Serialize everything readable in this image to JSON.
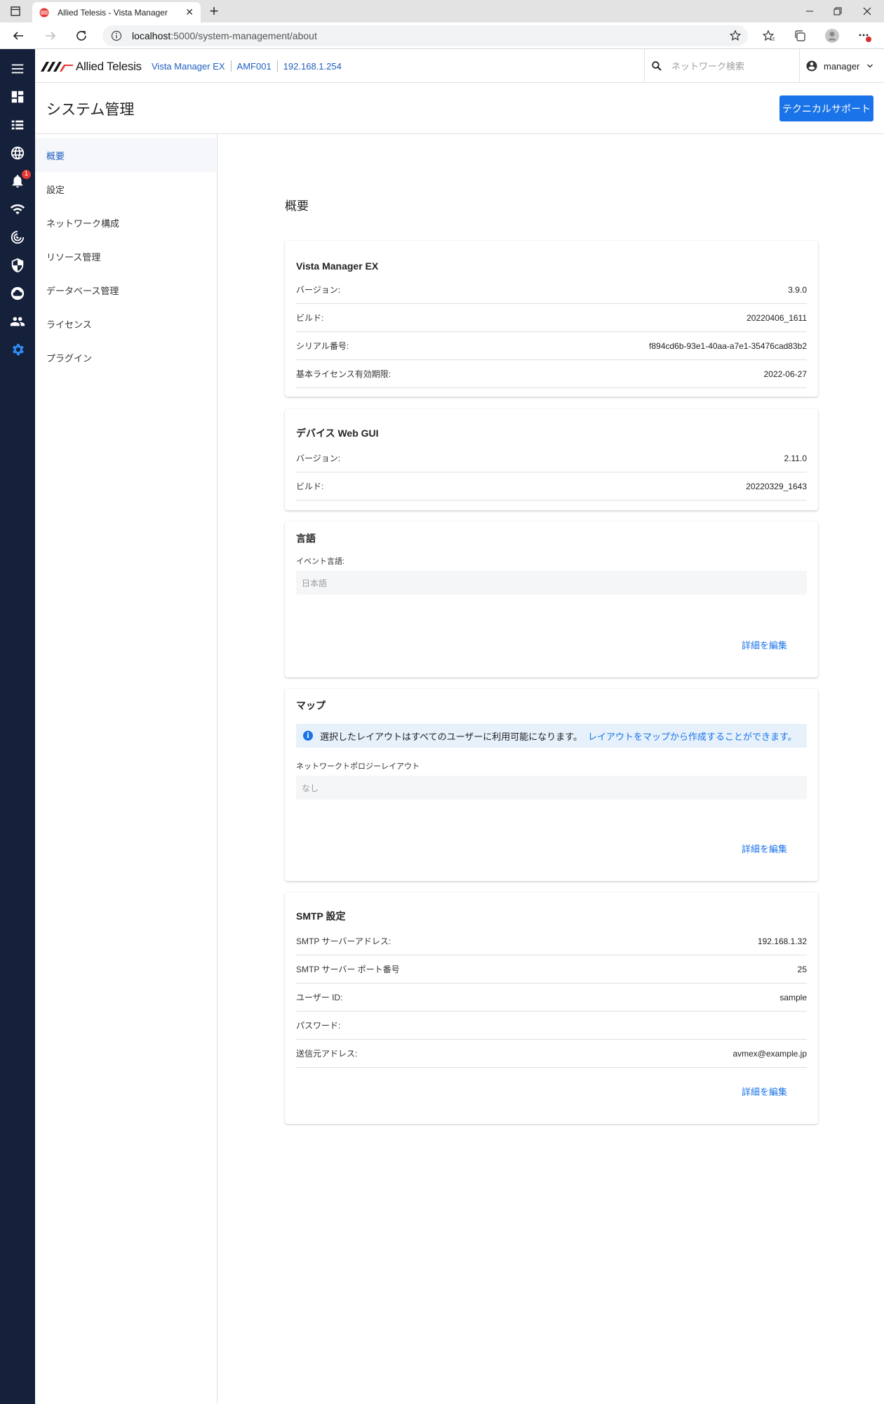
{
  "browser": {
    "tab_title": "Allied Telesis - Vista Manager",
    "url_host": "localhost",
    "url_path": ":5000/system-management/about"
  },
  "header": {
    "logo_text": "Allied Telesis",
    "product": "Vista Manager EX",
    "device": "AMF001",
    "ip": "192.168.1.254",
    "search_placeholder": "ネットワーク検索",
    "user": "manager"
  },
  "rail": {
    "alarm_count": "1",
    "icons": [
      "menu-icon",
      "dashboard-icon",
      "list-icon",
      "globe-icon",
      "bell-icon",
      "wifi-icon",
      "radar-icon",
      "shield-icon",
      "cloud-icon",
      "people-icon",
      "gear-icon"
    ]
  },
  "page": {
    "title": "システム管理",
    "support_button": "テクニカルサポート"
  },
  "sidenav": {
    "items": [
      "概要",
      "設定",
      "ネットワーク構成",
      "リソース管理",
      "データベース管理",
      "ライセンス",
      "プラグイン"
    ],
    "active": "概要"
  },
  "main": {
    "heading": "概要",
    "vme": {
      "title": "Vista Manager EX",
      "rows": [
        {
          "k": "バージョン:",
          "v": "3.9.0"
        },
        {
          "k": "ビルド:",
          "v": "20220406_1611"
        },
        {
          "k": "シリアル番号:",
          "v": "f894cd6b-93e1-40aa-a7e1-35476cad83b2"
        },
        {
          "k": "基本ライセンス有効期限:",
          "v": "2022-06-27"
        }
      ]
    },
    "webgui": {
      "title": "デバイス Web GUI",
      "rows": [
        {
          "k": "バージョン:",
          "v": "2.11.0"
        },
        {
          "k": "ビルド:",
          "v": "20220329_1643"
        }
      ]
    },
    "language": {
      "title": "言語",
      "field_label": "イベント言語:",
      "field_value": "日本語",
      "edit": "詳細を編集"
    },
    "map": {
      "title": "マップ",
      "info_text": "選択したレイアウトはすべてのユーザーに利用可能になります。",
      "info_link": "レイアウトをマップから作成することができます。",
      "field_label": "ネットワークトポロジーレイアウト",
      "field_value": "なし",
      "edit": "詳細を編集"
    },
    "smtp": {
      "title": "SMTP 設定",
      "rows": [
        {
          "k": "SMTP サーバーアドレス:",
          "v": "192.168.1.32"
        },
        {
          "k": "SMTP サーバー ポート番号",
          "v": "25"
        },
        {
          "k": "ユーザー ID:",
          "v": "sample"
        },
        {
          "k": "パスワード:",
          "v": ""
        },
        {
          "k": "送信元アドレス:",
          "v": "avmex@example.jp"
        }
      ],
      "edit": "詳細を編集"
    }
  },
  "colors": {
    "rail_bg": "#15203a",
    "accent": "#1a73e8",
    "link": "#1f5fc0",
    "badge": "#e53935"
  }
}
